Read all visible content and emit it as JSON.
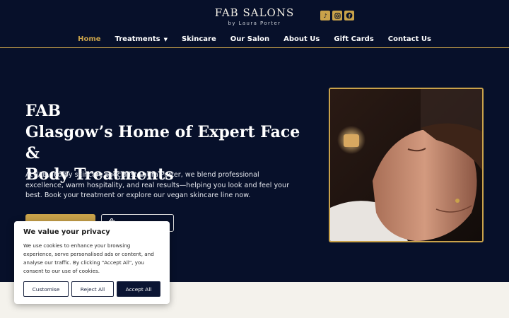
{
  "header": {
    "logo_main": "FAB SALONS",
    "logo_sub": "by Laura Porter",
    "social_icons": [
      "tiktok-icon",
      "instagram-icon",
      "facebook-icon"
    ]
  },
  "nav": {
    "items": [
      {
        "label": "Home",
        "active": true
      },
      {
        "label": "Treatments",
        "dropdown": true
      },
      {
        "label": "Skincare"
      },
      {
        "label": "Our Salon"
      },
      {
        "label": "About Us"
      },
      {
        "label": "Gift Cards"
      },
      {
        "label": "Contact Us"
      }
    ]
  },
  "hero": {
    "title_line1": "FAB",
    "title_line2": "Glasgow’s Home of Expert Face &",
    "title_line3": "Body Treatments",
    "text": "At FAB, led by skincare specialist Laura Porter, we blend professional excellence, warm hospitality, and real results—helping you look and feel your best. Book your treatment or explore our vegan skincare line now."
  },
  "cookie": {
    "title": "We value your privacy",
    "body": "We use cookies to enhance your browsing experience, serve personalised ads or content, and analyse our traffic. By clicking \"Accept All\", you consent to our use of cookies.",
    "customise": "Customise",
    "reject": "Reject All",
    "accept": "Accept All"
  },
  "colors": {
    "navy": "#07102a",
    "gold": "#c9a24a",
    "band": "#f4f2ec"
  }
}
